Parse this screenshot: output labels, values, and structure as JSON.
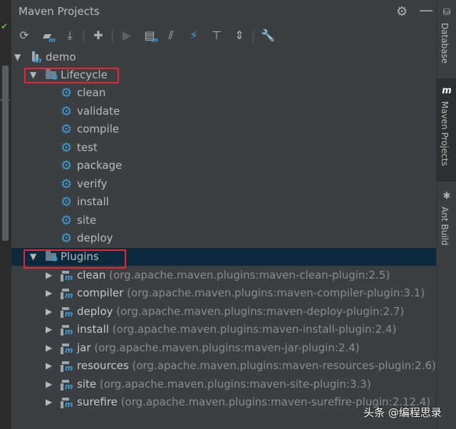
{
  "panel": {
    "title": "Maven Projects",
    "gear_icon": "gear-icon",
    "minimize_icon": "minimize-icon"
  },
  "toolbar": {
    "buttons": [
      {
        "name": "reimport-button",
        "icon": "refresh-icon"
      },
      {
        "name": "generate-sources-button",
        "icon": "folder-refresh-icon"
      },
      {
        "name": "download-sources-button",
        "icon": "download-icon"
      },
      {
        "name": "add-project-button",
        "icon": "plus-icon"
      },
      {
        "name": "run-build-button",
        "icon": "play-icon"
      },
      {
        "name": "execute-goal-button",
        "icon": "maven-goal-icon"
      },
      {
        "name": "toggle-offline-button",
        "icon": "offline-icon"
      },
      {
        "name": "skip-tests-button",
        "icon": "lightning-icon"
      },
      {
        "name": "show-dependencies-button",
        "icon": "diagram-icon"
      },
      {
        "name": "collapse-all-button",
        "icon": "collapse-icon"
      },
      {
        "name": "settings-button",
        "icon": "wrench-icon"
      }
    ]
  },
  "tree": {
    "root": "demo",
    "lifecycle": {
      "label": "Lifecycle",
      "goals": [
        "clean",
        "validate",
        "compile",
        "test",
        "package",
        "verify",
        "install",
        "site",
        "deploy"
      ]
    },
    "plugins": {
      "label": "Plugins",
      "items": [
        {
          "name": "clean",
          "coord": "(org.apache.maven.plugins:maven-clean-plugin:2.5)"
        },
        {
          "name": "compiler",
          "coord": "(org.apache.maven.plugins:maven-compiler-plugin:3.1)"
        },
        {
          "name": "deploy",
          "coord": "(org.apache.maven.plugins:maven-deploy-plugin:2.7)"
        },
        {
          "name": "install",
          "coord": "(org.apache.maven.plugins:maven-install-plugin:2.4)"
        },
        {
          "name": "jar",
          "coord": "(org.apache.maven.plugins:maven-jar-plugin:2.4)"
        },
        {
          "name": "resources",
          "coord": "(org.apache.maven.plugins:maven-resources-plugin:2.6)"
        },
        {
          "name": "site",
          "coord": "(org.apache.maven.plugins:maven-site-plugin:3.3)"
        },
        {
          "name": "surefire",
          "coord": "(org.apache.maven.plugins:maven-surefire-plugin:2.12.4)"
        }
      ]
    }
  },
  "sidebar": {
    "tabs": [
      {
        "label": "Database",
        "icon": "database-icon"
      },
      {
        "label": "Maven Projects",
        "icon": "maven-icon",
        "active": true
      },
      {
        "label": "Ant Build",
        "icon": "ant-icon"
      }
    ]
  },
  "watermark": "头条 @编程思录",
  "colors": {
    "panel_bg": "#3c3f41",
    "selection_bg": "#0d293e",
    "accent_blue": "#3a9fd8",
    "highlight_box": "#e8262f"
  }
}
